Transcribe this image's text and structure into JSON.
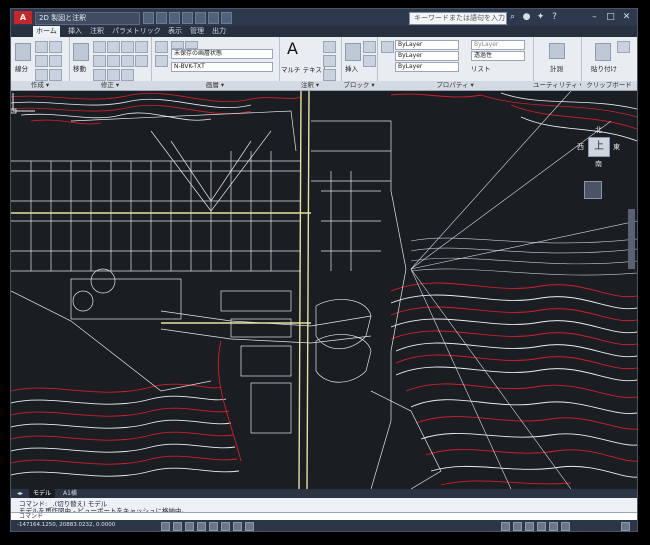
{
  "titlebar": {
    "app_logo": "A",
    "qat_workspace": "2D 製図と注釈",
    "search_placeholder": "キーワードまたは語句を入力",
    "window_buttons": [
      "–",
      "□",
      "✕"
    ]
  },
  "tabs": [
    "ホーム",
    "挿入",
    "注釈",
    "パラメトリック",
    "表示",
    "管理",
    "出力"
  ],
  "ribbon": {
    "panels": [
      {
        "name": "draw",
        "label": "作成 ▾"
      },
      {
        "name": "modify",
        "label": "修正 ▾"
      },
      {
        "name": "layers",
        "label": "画層 ▾"
      },
      {
        "name": "annotation",
        "label": "注釈 ▾"
      },
      {
        "name": "block",
        "label": "ブロック ▾"
      },
      {
        "name": "properties",
        "label": "プロパティ ▾"
      },
      {
        "name": "utilities",
        "label": "ユーティリティ ▾"
      },
      {
        "name": "clipboard",
        "label": "クリップボード"
      }
    ],
    "draw_line_label": "線分",
    "modify_move_label": "移動",
    "layer_combo": "未保存の画層状態",
    "layer_name_combo": "N-BVK-TXT",
    "mtext_label": "マルチ テキスト",
    "insert_label": "挿入",
    "bylayer_color": "ByLayer",
    "bylayer_linetype": "ByLayer",
    "bylayer_lineweight": "ByLayer",
    "transparency": "透過性",
    "list_label": "リスト",
    "measure_label": "計測",
    "paste_label": "貼り付け"
  },
  "viewcube": {
    "top": "上",
    "north": "北",
    "south": "南",
    "east": "東",
    "west": "西"
  },
  "layout_tabs": [
    "モデル",
    "A1横"
  ],
  "command": {
    "line1": "コマンド: _.(切り替え) モデル",
    "line2": "モデルを再作図中 - ビューポートをキャッシュに格納中。",
    "input_placeholder": "コマンド"
  },
  "status": {
    "coords": "-147164.1250, 20883.0232, 0.0000"
  },
  "colors": {
    "canvas": "#1a1d22",
    "contour_red": "#d11f2b",
    "contour_white": "#e9edf2",
    "road_yellow": "#e7e09a"
  }
}
